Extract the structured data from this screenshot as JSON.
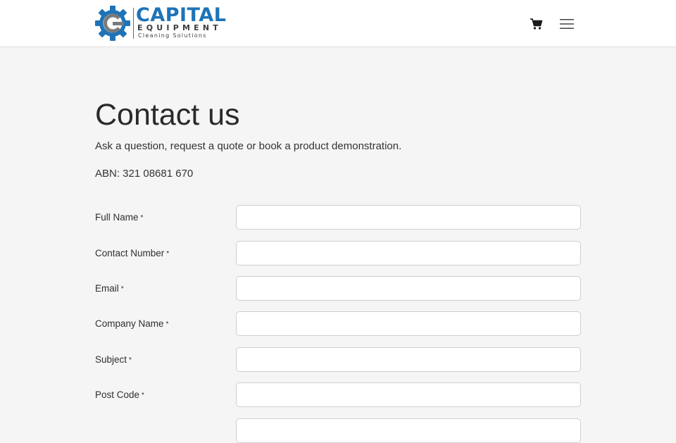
{
  "header": {
    "logo": {
      "name": "CAPITAL",
      "line2": "EQUIPMENT",
      "tagline": "Cleaning Solutions",
      "gear_color": "#1f73b7",
      "c_color": "#7a7a7a"
    },
    "icons": {
      "cart": "shopping-cart-icon",
      "menu": "hamburger-menu-icon"
    }
  },
  "page": {
    "title": "Contact us",
    "lead": "Ask a question, request a quote or book a product demonstration.",
    "abn": "ABN: 321 08681 670"
  },
  "form": {
    "required_marker": "*",
    "fields": [
      {
        "label": "Full Name",
        "value": ""
      },
      {
        "label": "Contact Number",
        "value": ""
      },
      {
        "label": "Email",
        "value": ""
      },
      {
        "label": "Company Name",
        "value": ""
      },
      {
        "label": "Subject",
        "value": ""
      },
      {
        "label": "Post Code",
        "value": ""
      }
    ]
  },
  "colors": {
    "brand_blue": "#1f73b7",
    "background": "#f6f5f5",
    "text": "#2b2b2b"
  }
}
